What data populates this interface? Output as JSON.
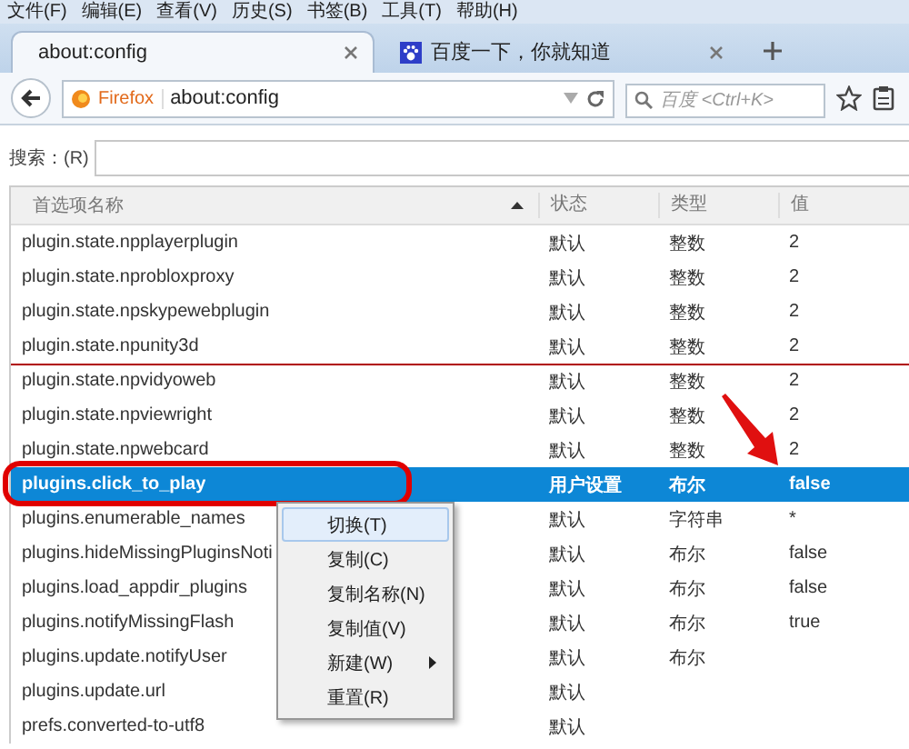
{
  "menubar": [
    "文件(F)",
    "编辑(E)",
    "查看(V)",
    "历史(S)",
    "书签(B)",
    "工具(T)",
    "帮助(H)"
  ],
  "tabs": [
    {
      "title": "about:config",
      "selected": true,
      "kind": "plain"
    },
    {
      "title": "百度一下，你就知道",
      "selected": false,
      "kind": "paw"
    }
  ],
  "address": {
    "identity": "Firefox",
    "url": "about:config"
  },
  "search_engine": {
    "placeholder": "百度 <Ctrl+K>"
  },
  "filter": {
    "label": "搜索：(R)"
  },
  "table": {
    "columns": [
      "首选项名称",
      "状态",
      "类型",
      "值"
    ],
    "rows": [
      {
        "name": "plugin.state.npplayerplugin",
        "status": "默认",
        "type": "整数",
        "value": "2",
        "selected": false
      },
      {
        "name": "plugin.state.nprobloxproxy",
        "status": "默认",
        "type": "整数",
        "value": "2",
        "selected": false
      },
      {
        "name": "plugin.state.npskypewebplugin",
        "status": "默认",
        "type": "整数",
        "value": "2",
        "selected": false
      },
      {
        "name": "plugin.state.npunity3d",
        "status": "默认",
        "type": "整数",
        "value": "2",
        "selected": false
      },
      {
        "name": "plugin.state.npvidyoweb",
        "status": "默认",
        "type": "整数",
        "value": "2",
        "selected": false
      },
      {
        "name": "plugin.state.npviewright",
        "status": "默认",
        "type": "整数",
        "value": "2",
        "selected": false
      },
      {
        "name": "plugin.state.npwebcard",
        "status": "默认",
        "type": "整数",
        "value": "2",
        "selected": false
      },
      {
        "name": "plugins.click_to_play",
        "status": "用户设置",
        "type": "布尔",
        "value": "false",
        "selected": true
      },
      {
        "name": "plugins.enumerable_names",
        "status": "默认",
        "type": "字符串",
        "value": "*",
        "selected": false
      },
      {
        "name": "plugins.hideMissingPluginsNoti",
        "status": "默认",
        "type": "布尔",
        "value": "false",
        "selected": false
      },
      {
        "name": "plugins.load_appdir_plugins",
        "status": "默认",
        "type": "布尔",
        "value": "false",
        "selected": false
      },
      {
        "name": "plugins.notifyMissingFlash",
        "status": "默认",
        "type": "布尔",
        "value": "true",
        "selected": false
      },
      {
        "name": "plugins.update.notifyUser",
        "status": "默认",
        "type": "布尔",
        "selected": false
      },
      {
        "name": "plugins.update.url",
        "status": "默认",
        "selected": false
      },
      {
        "name": "prefs.converted-to-utf8",
        "status": "默认",
        "selected": false
      }
    ]
  },
  "context_menu": {
    "items": [
      {
        "label": "切换(T)",
        "selected": true,
        "submenu": false
      },
      {
        "label": "复制(C)",
        "selected": false,
        "submenu": false
      },
      {
        "label": "复制名称(N)",
        "selected": false,
        "submenu": false
      },
      {
        "label": "复制值(V)",
        "selected": false,
        "submenu": false
      },
      {
        "label": "新建(W)",
        "selected": false,
        "submenu": true
      },
      {
        "label": "重置(R)",
        "selected": false,
        "submenu": false
      }
    ]
  }
}
